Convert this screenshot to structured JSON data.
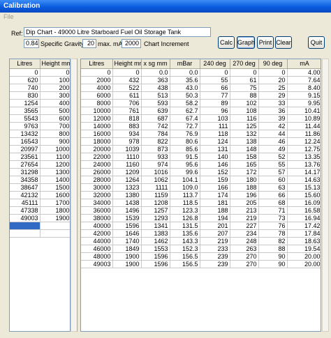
{
  "window": {
    "title": "Calibration"
  },
  "menu": {
    "file_label": "File"
  },
  "ref": {
    "label": "Ref:",
    "value": "Dip Chart - 49000 Litre Starboard Fuel Oil Storage Tank"
  },
  "params": {
    "specific_gravity": {
      "value": "0.84",
      "label": "Specific Gravity"
    },
    "max_ma": {
      "value": "20",
      "label": "max. mA"
    },
    "chart_increment": {
      "value": "2000",
      "label": "Chart Increment"
    }
  },
  "buttons": {
    "calc": "Calc",
    "graph": "Graph",
    "print": "Print",
    "clear": "Clear",
    "quit": "Quit"
  },
  "left_grid": {
    "headers": [
      "Litres",
      "Height mm"
    ],
    "rows": [
      [
        "0",
        "0"
      ],
      [
        "620",
        "100"
      ],
      [
        "740",
        "200"
      ],
      [
        "830",
        "300"
      ],
      [
        "1254",
        "400"
      ],
      [
        "3565",
        "500"
      ],
      [
        "5543",
        "600"
      ],
      [
        "9763",
        "700"
      ],
      [
        "13432",
        "800"
      ],
      [
        "16543",
        "900"
      ],
      [
        "20997",
        "1000"
      ],
      [
        "23561",
        "1100"
      ],
      [
        "27654",
        "1200"
      ],
      [
        "31298",
        "1300"
      ],
      [
        "34358",
        "1400"
      ],
      [
        "38647",
        "1500"
      ],
      [
        "42132",
        "1600"
      ],
      [
        "45111",
        "1700"
      ],
      [
        "47338",
        "1800"
      ],
      [
        "49003",
        "1900"
      ]
    ]
  },
  "right_grid": {
    "headers": [
      "Litres",
      "Height mm",
      "x sg mm",
      "mBar",
      "240 deg",
      "270 deg",
      "90 deg",
      "mA"
    ],
    "rows": [
      [
        "0",
        "0",
        "0.0",
        "0.0",
        "0",
        "0",
        "0",
        "4.00"
      ],
      [
        "2000",
        "432",
        "363",
        "35.6",
        "55",
        "61",
        "20",
        "7.64"
      ],
      [
        "4000",
        "522",
        "438",
        "43.0",
        "66",
        "75",
        "25",
        "8.40"
      ],
      [
        "6000",
        "611",
        "513",
        "50.3",
        "77",
        "88",
        "29",
        "9.15"
      ],
      [
        "8000",
        "706",
        "593",
        "58.2",
        "89",
        "102",
        "33",
        "9.95"
      ],
      [
        "10000",
        "761",
        "639",
        "62.7",
        "96",
        "108",
        "36",
        "10.41"
      ],
      [
        "12000",
        "818",
        "687",
        "67.4",
        "103",
        "116",
        "39",
        "10.89"
      ],
      [
        "14000",
        "883",
        "742",
        "72.7",
        "111",
        "125",
        "42",
        "11.44"
      ],
      [
        "16000",
        "934",
        "784",
        "76.9",
        "118",
        "132",
        "44",
        "11.86"
      ],
      [
        "18000",
        "978",
        "822",
        "80.6",
        "124",
        "138",
        "46",
        "12.24"
      ],
      [
        "20000",
        "1039",
        "873",
        "85.6",
        "131",
        "148",
        "49",
        "12.75"
      ],
      [
        "22000",
        "1110",
        "933",
        "91.5",
        "140",
        "158",
        "52",
        "13.35"
      ],
      [
        "24000",
        "1160",
        "974",
        "95.6",
        "146",
        "165",
        "55",
        "13.76"
      ],
      [
        "26000",
        "1209",
        "1016",
        "99.6",
        "152",
        "172",
        "57",
        "14.17"
      ],
      [
        "28000",
        "1264",
        "1062",
        "104.1",
        "159",
        "180",
        "60",
        "14.63"
      ],
      [
        "30000",
        "1323",
        "1111",
        "109.0",
        "166",
        "188",
        "63",
        "15.13"
      ],
      [
        "32000",
        "1380",
        "1159",
        "113.7",
        "174",
        "196",
        "66",
        "15.60"
      ],
      [
        "34000",
        "1438",
        "1208",
        "118.5",
        "181",
        "205",
        "68",
        "16.09"
      ],
      [
        "36000",
        "1496",
        "1257",
        "123.3",
        "188",
        "213",
        "71",
        "16.58"
      ],
      [
        "38000",
        "1539",
        "1293",
        "126.8",
        "194",
        "219",
        "73",
        "16.94"
      ],
      [
        "40000",
        "1596",
        "1341",
        "131.5",
        "201",
        "227",
        "76",
        "17.42"
      ],
      [
        "42000",
        "1646",
        "1383",
        "135.6",
        "207",
        "234",
        "78",
        "17.84"
      ],
      [
        "44000",
        "1740",
        "1462",
        "143.3",
        "219",
        "248",
        "82",
        "18.63"
      ],
      [
        "46000",
        "1849",
        "1553",
        "152.3",
        "233",
        "263",
        "88",
        "19.54"
      ],
      [
        "48000",
        "1900",
        "1596",
        "156.5",
        "239",
        "270",
        "90",
        "20.00"
      ],
      [
        "49003",
        "1900",
        "1596",
        "156.5",
        "239",
        "270",
        "90",
        "20.00"
      ]
    ]
  }
}
